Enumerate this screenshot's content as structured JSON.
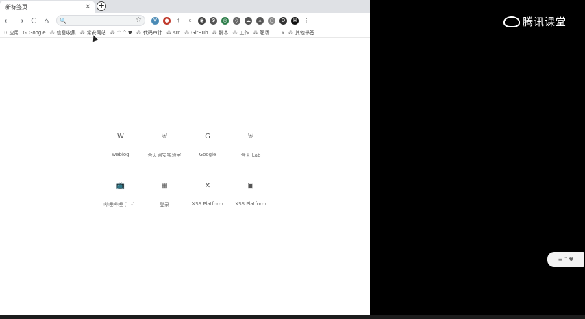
{
  "tab": {
    "title": "新标签页",
    "close": "×"
  },
  "toolbar": {
    "back": "←",
    "forward": "→",
    "reload": "C",
    "home": "⌂",
    "omnibox_icon": "🔍",
    "omnibox_value": "",
    "star": "☆"
  },
  "extensions": [
    {
      "icon": "v-icon",
      "color": "#4a8ab5",
      "glyph": "V"
    },
    {
      "icon": "red-circle-icon",
      "color": "#c0392b",
      "glyph": "●"
    },
    {
      "icon": "pin-icon",
      "color": "#777",
      "glyph": "†"
    },
    {
      "icon": "c-icon",
      "color": "#777",
      "glyph": "c"
    },
    {
      "icon": "target-icon",
      "color": "#444",
      "glyph": "◉"
    },
    {
      "icon": "gear-icon",
      "color": "#555",
      "glyph": "⚙"
    },
    {
      "icon": "chrome-icon",
      "color": "#2d7d4a",
      "glyph": "◎"
    },
    {
      "icon": "shield-icon",
      "color": "#666",
      "glyph": "◇"
    },
    {
      "icon": "cloud-icon",
      "color": "#555",
      "glyph": "☁"
    },
    {
      "icon": "lambda-icon",
      "color": "#555",
      "glyph": "λ"
    },
    {
      "icon": "circle-icon",
      "color": "#888",
      "glyph": "○"
    },
    {
      "icon": "d-icon",
      "color": "#333",
      "glyph": "D"
    },
    {
      "icon": "h-icon",
      "color": "#111",
      "glyph": "H"
    },
    {
      "icon": "menu-icon",
      "color": "#555",
      "glyph": "⋮"
    }
  ],
  "bookmarks": [
    {
      "icon": "apps-icon",
      "label": "应用"
    },
    {
      "icon": "google-icon",
      "label": "Google"
    },
    {
      "icon": "folder-icon",
      "label": "信息收集"
    },
    {
      "icon": "folder-icon",
      "label": "常安网站"
    },
    {
      "icon": "folder-icon",
      "label": "^ ^ ♥"
    },
    {
      "icon": "folder-icon",
      "label": "代码审计"
    },
    {
      "icon": "folder-icon",
      "label": "src"
    },
    {
      "icon": "folder-icon",
      "label": "GitHub"
    },
    {
      "icon": "folder-icon",
      "label": "脚本"
    },
    {
      "icon": "folder-icon",
      "label": "工作"
    },
    {
      "icon": "folder-icon",
      "label": "靶场"
    },
    {
      "icon": "more-icon",
      "label": "»"
    },
    {
      "icon": "folder-icon",
      "label": "其他书签"
    }
  ],
  "shortcuts": [
    {
      "icon": "w-icon",
      "glyph": "W",
      "label": "weblog"
    },
    {
      "icon": "shield-icon",
      "glyph": "⛨",
      "label": "合天网安实验室"
    },
    {
      "icon": "google-icon",
      "glyph": "G",
      "label": "Google"
    },
    {
      "icon": "shield-icon",
      "glyph": "⛨",
      "label": "合天 Lab"
    },
    {
      "icon": "tv-icon",
      "glyph": "📺",
      "label": "哔哩哔哩 (゜-゜"
    },
    {
      "icon": "grid-icon",
      "glyph": "▦",
      "label": "登录"
    },
    {
      "icon": "x-icon",
      "glyph": "✕",
      "label": "XSS Platform"
    },
    {
      "icon": "square-icon",
      "glyph": "▣",
      "label": "XSS Platform"
    }
  ],
  "watermark": {
    "text": "腾讯课堂"
  },
  "widget": {
    "text": "≡ ˆ ♥"
  }
}
